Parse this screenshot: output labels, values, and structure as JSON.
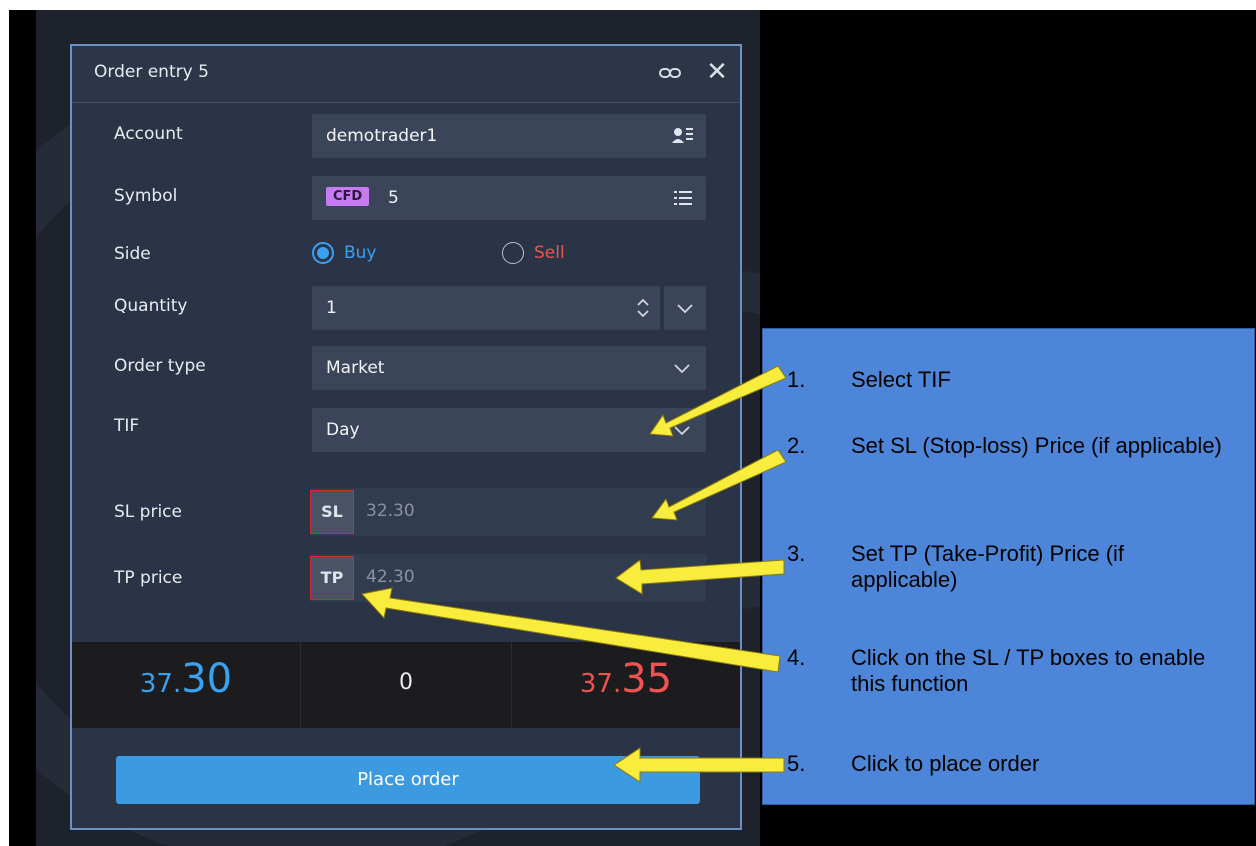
{
  "dialog": {
    "title": "Order entry 5",
    "link_icon": "link-icon",
    "close_icon": "close-icon",
    "close_glyph": "✕"
  },
  "form": {
    "account_label": "Account",
    "account_value": "demotrader1",
    "symbol_label": "Symbol",
    "symbol_badge": "CFD",
    "symbol_value": "5",
    "side_label": "Side",
    "side_buy": "Buy",
    "side_sell": "Sell",
    "side_selected": "Buy",
    "quantity_label": "Quantity",
    "quantity_value": "1",
    "order_type_label": "Order type",
    "order_type_value": "Market",
    "tif_label": "TIF",
    "tif_value": "Day",
    "sl_label": "SL price",
    "sl_box": "SL",
    "sl_value": "32.30",
    "tp_label": "TP price",
    "tp_box": "TP",
    "tp_value": "42.30"
  },
  "quote": {
    "bid_prefix": "37.",
    "bid_main": "30",
    "spread": "0",
    "ask_prefix": "37.",
    "ask_main": "35"
  },
  "place_order_label": "Place order",
  "callout": {
    "steps": [
      {
        "num": "1.",
        "text": "Select TIF"
      },
      {
        "num": "2.",
        "text": "Set SL (Stop-loss) Price (if applicable)"
      },
      {
        "num": "3.",
        "text": "Set TP (Take-Profit) Price (if applicable)"
      },
      {
        "num": "4.",
        "text": "Click on the SL / TP  boxes to enable this function"
      },
      {
        "num": "5.",
        "text": "Click to place order"
      }
    ]
  },
  "colors": {
    "buy_blue": "#3aa0f0",
    "sell_red": "#ef5350",
    "arrow_yellow": "#f8ec3c",
    "callout_bg": "#4d86d8",
    "cfd_badge": "#c77bf0"
  }
}
